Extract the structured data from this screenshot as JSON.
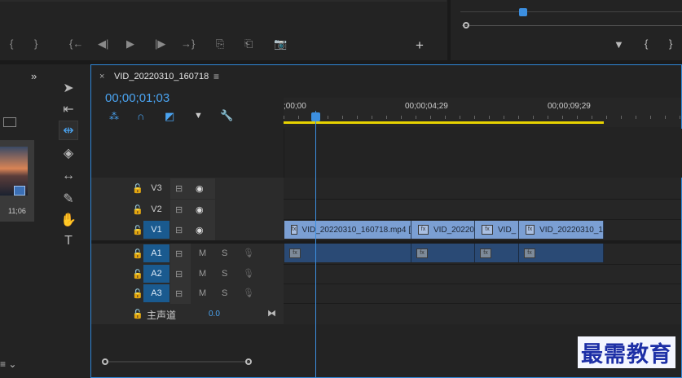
{
  "top_left_transport": [
    "{",
    "}",
    "{←",
    "◀|",
    "▶",
    "|▶",
    "→}",
    "⎘",
    "⎗",
    "📷",
    "+"
  ],
  "top_right_markers": [
    "▼",
    "{",
    "}",
    "»"
  ],
  "timeline": {
    "tab_close": "×",
    "sequence_name": "VID_20220310_160718",
    "menu_icon": "≡",
    "timecode": "00;00;01;03",
    "ruler_ticks": [
      ";00;00",
      "00;00;04;29",
      "00;00;09;29"
    ],
    "master_label": "主声道",
    "master_value": "0.0"
  },
  "video_tracks": [
    {
      "name": "V3",
      "active": false
    },
    {
      "name": "V2",
      "active": false
    },
    {
      "name": "V1",
      "active": true
    }
  ],
  "audio_tracks": [
    {
      "name": "A1",
      "active": true,
      "m": "M",
      "s": "S"
    },
    {
      "name": "A2",
      "active": true,
      "m": "M",
      "s": "S"
    },
    {
      "name": "A3",
      "active": true,
      "m": "M",
      "s": "S"
    }
  ],
  "v1_clips": [
    "VID_20220310_160718.mp4 [",
    "VID_20220",
    "VID_",
    "VID_20220310_1"
  ],
  "fx_label": "fx",
  "project": {
    "thumb_duration": "11;06",
    "expand_icon": "»"
  },
  "watermark": "最需教育"
}
